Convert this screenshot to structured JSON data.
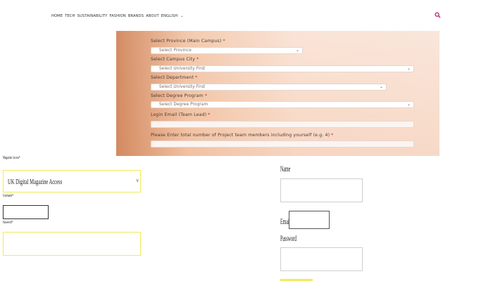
{
  "nav": {
    "items": [
      "HOME",
      "TECH",
      "SUSTAINABILITY",
      "FASHION",
      "BRANDS",
      "ABOUT",
      "ENGLISH"
    ],
    "language_chevron": "⌄",
    "search_icon": "search-icon",
    "accent_color": "#b0217a"
  },
  "registration_form": {
    "province_label": "Select Province (Main Campus)",
    "province_value": "Select Province",
    "campus_city_label": "Select Campus City",
    "campus_city_value": "Select University First",
    "department_label": "Select Department",
    "department_value": "Select University First",
    "degree_label": "Select Degree Program",
    "degree_value": "Select Degree Program",
    "login_email_label": "Login Email (Team Lead)",
    "members_label": "Please Enter total number of Project team members including yourself (e.g. 4)",
    "required_mark": "*"
  },
  "magazine_form": {
    "access_label": "Magazine Access*",
    "access_value": "UK Digital Magazine Access",
    "username_label": "Username*",
    "password_label": "Password*"
  },
  "signup_form": {
    "name_label": "Name",
    "email_label": "Email",
    "password_label": "Password"
  }
}
